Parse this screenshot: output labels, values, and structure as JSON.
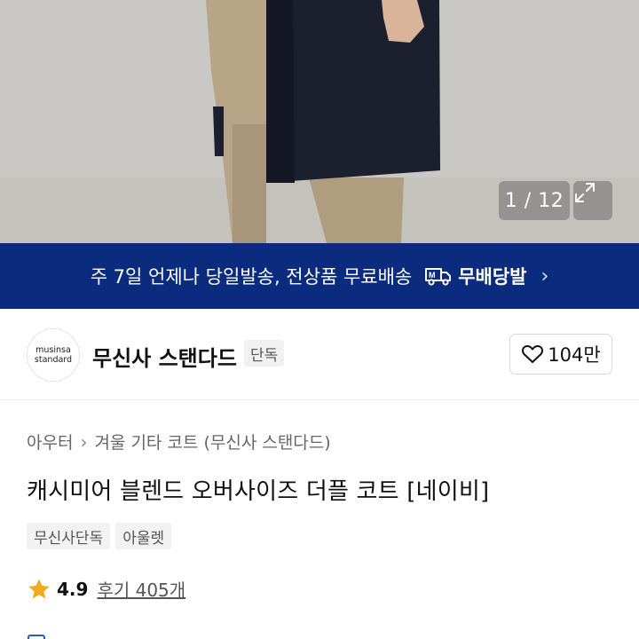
{
  "gallery": {
    "counter": "1 / 12",
    "expand_icon": "expand-arrows-icon"
  },
  "banner": {
    "text": "주 7일 언제나 당일발송, 전상품 무료배송",
    "brand_label": "무배당발",
    "brand_icon": "delivery-truck-icon",
    "chevron_icon": "chevron-right-icon",
    "color": "#0b2b7e"
  },
  "brand": {
    "logo_line1": "musinsa",
    "logo_line2": "standard",
    "name": "무신사 스탠다드",
    "badge": "단독",
    "likes": "104만",
    "like_icon": "heart-outline-icon"
  },
  "product": {
    "breadcrumb": [
      "아우터",
      "겨울 기타 코트 (무신사 스탠다드)"
    ],
    "title": "캐시미어 블렌드 오버사이즈 더플 코트 [네이비]",
    "tags": [
      "무신사단독",
      "아울렛"
    ],
    "rating": "4.9",
    "reviews": "후기 405개",
    "star_color": "#f2a91d"
  }
}
